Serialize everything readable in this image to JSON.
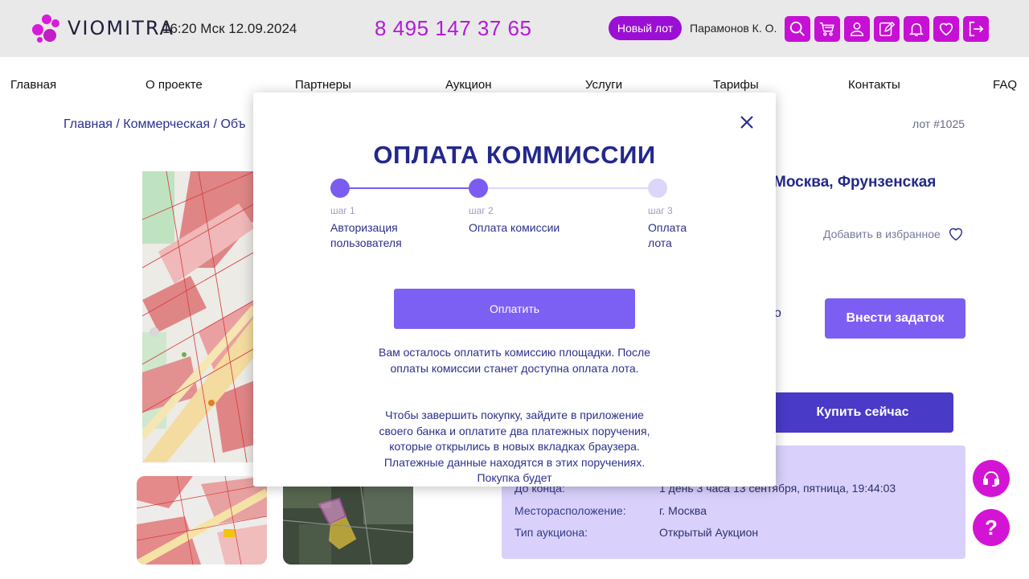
{
  "header": {
    "logo_text": "VIOMITRA",
    "datetime": "16:20 Мск 12.09.2024",
    "phone": "8 495 147 37 65",
    "new_lot_label": "Новый лот",
    "user_name": "Парамонов К. О.",
    "icons": [
      "search-icon",
      "cart-icon",
      "user-icon",
      "edit-icon",
      "bell-icon",
      "heart-icon",
      "logout-icon"
    ],
    "accent_color": "#c610d4"
  },
  "nav": {
    "items": [
      "Главная",
      "О проекте",
      "Партнеры",
      "Аукцион",
      "Услуги",
      "Тарифы",
      "Контакты",
      "FAQ"
    ]
  },
  "breadcrumb": {
    "items": [
      "Главная",
      "Коммерческая",
      "Объ"
    ],
    "separator": "/"
  },
  "lot": {
    "number": "лот #1025",
    "title_fragment": "Москва, Фрунзенская",
    "favorite_label": "Добавить в избранное",
    "price_fragment": "о",
    "deposit_button": "Внести задаток",
    "buy_now_button": "Купить сейчас",
    "info": [
      {
        "key": "До конца:",
        "value": "1 день 3 часа 13 сентября, пятница, 19:44:03"
      },
      {
        "key": "Месторасположение:",
        "value": "г. Москва"
      },
      {
        "key": "Тип аукциона:",
        "value": "Открытый Аукцион"
      }
    ]
  },
  "modal": {
    "title": "ОПЛАТА КОММИССИИ",
    "steps": [
      {
        "label": "шаг 1",
        "name": "Авторизация пользователя",
        "state": "done"
      },
      {
        "label": "шаг 2",
        "name": "Оплата комиссии",
        "state": "active"
      },
      {
        "label": "шаг 3",
        "name": "Оплата лота",
        "state": "pending"
      }
    ],
    "pay_button": "Оплатить",
    "text_1": "Вам осталось оплатить комиссию площадки. После оплаты комиссии станет доступна оплата лота.",
    "text_2": "Чтобы завершить покупку, зайдите в приложение своего банка и оплатите два платежных поручения, которые открылись в новых вкладках браузера. Платежные данные находятся в этих поручениях. Покупка будет",
    "colors": {
      "step_active": "#7b5cf0",
      "step_pending": "#dcd6fb",
      "title": "#23288c"
    }
  },
  "fabs": [
    "headset-icon",
    "help-icon"
  ],
  "fab_help_text": "?"
}
